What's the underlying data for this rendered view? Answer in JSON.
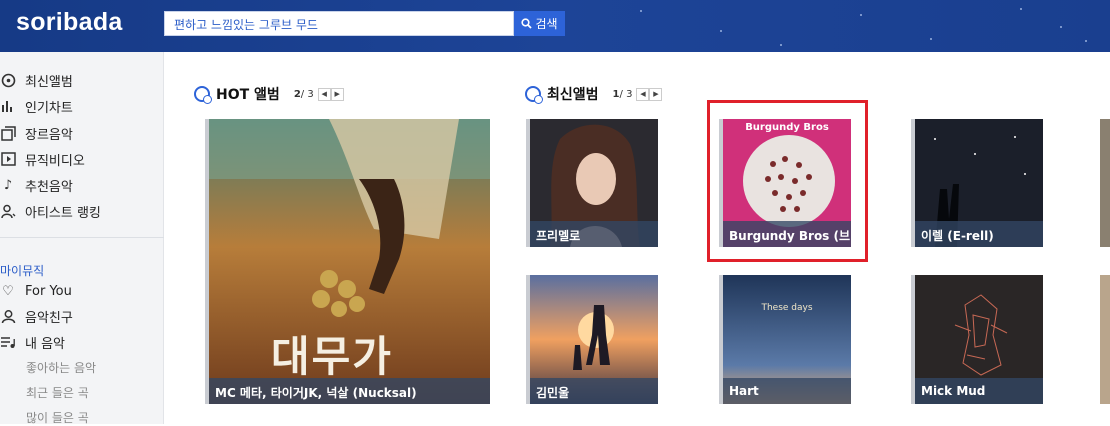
{
  "header": {
    "logo": "soribada",
    "search_value": "편하고 느낌있는 그루브 무드",
    "search_button": "검색"
  },
  "sidebar": {
    "items": [
      {
        "label": "최신앨범",
        "icon": "new-disc-icon"
      },
      {
        "label": "인기차트",
        "icon": "chart-bars-icon"
      },
      {
        "label": "장르음악",
        "icon": "stack-icon"
      },
      {
        "label": "뮤직비디오",
        "icon": "play-box-icon"
      },
      {
        "label": "추천음악",
        "icon": "music-note-icon"
      },
      {
        "label": "아티스트 랭킹",
        "icon": "user-rank-icon"
      }
    ],
    "my_music_label": "마이뮤직",
    "my_items": [
      {
        "label": "For You",
        "icon": "heart-icon"
      },
      {
        "label": "음악친구",
        "icon": "friends-icon"
      },
      {
        "label": "내 음악",
        "icon": "playlist-icon"
      }
    ],
    "sub_items": [
      "좋아하는 음악",
      "최근 들은 곡",
      "많이 들은 곡"
    ]
  },
  "hot": {
    "title": "HOT 앨범",
    "page_current": "2",
    "page_total": "3",
    "album": {
      "caption": "MC 메타, 타이거JK, 넉살 (Nucksal)",
      "cover_text": "대무가"
    }
  },
  "new": {
    "title": "최신앨범",
    "page_current": "1",
    "page_total": "3",
    "albums": [
      {
        "caption": "프리멜로"
      },
      {
        "caption": "Burgundy Bros (브",
        "cover_text": "Burgundy Bros"
      },
      {
        "caption": "이렐 (E-rell)"
      },
      {
        "caption": "김민울"
      },
      {
        "caption": "Hart",
        "cover_text": "These days"
      },
      {
        "caption": "Mick Mud"
      }
    ]
  },
  "colors": {
    "topbar": "#1d4497",
    "accent": "#2d63d8",
    "highlight": "#e0202a"
  }
}
